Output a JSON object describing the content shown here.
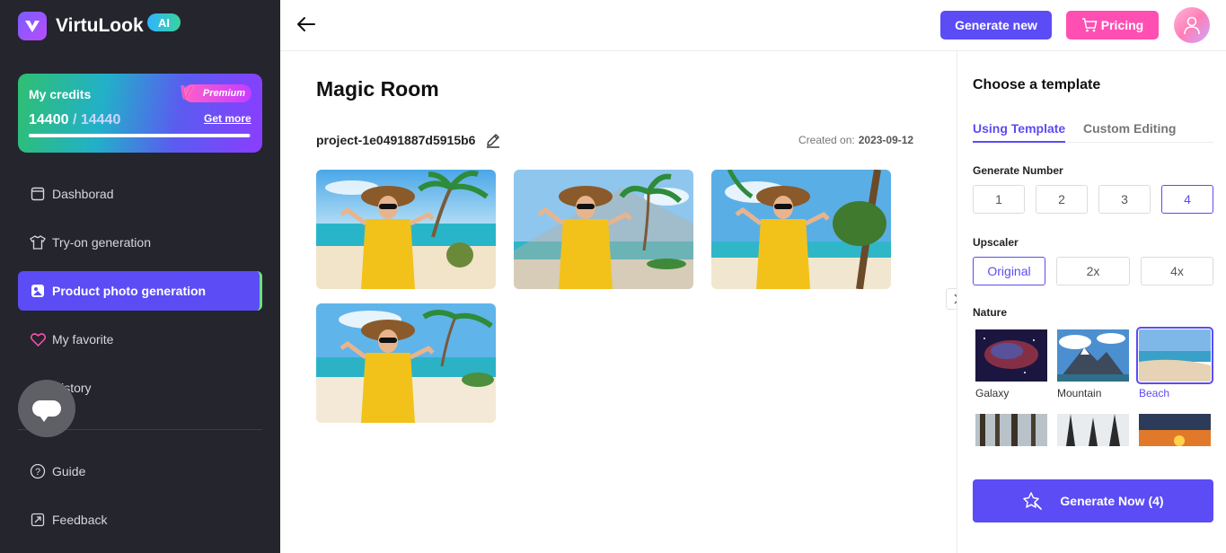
{
  "brand": {
    "name": "VirtuLook",
    "badge": "AI"
  },
  "credits": {
    "title": "My credits",
    "premium_label": "Premium",
    "premium_mark": "V",
    "used": "14400",
    "separator": "/",
    "total": "14440",
    "get_more": "Get more",
    "progress": 0.997
  },
  "nav": [
    {
      "label": "Dashborad",
      "icon": "dashboard-icon"
    },
    {
      "label": "Try-on generation",
      "icon": "shirt-icon"
    },
    {
      "label": "Product photo generation",
      "icon": "product-photo-icon",
      "active": true
    },
    {
      "label": "My favorite",
      "icon": "heart-icon"
    },
    {
      "label": "History",
      "icon": "history-icon"
    },
    {
      "label": "Guide",
      "icon": "help-icon"
    },
    {
      "label": "Feedback",
      "icon": "feedback-icon"
    }
  ],
  "header": {
    "generate_new": "Generate new",
    "pricing": "Pricing"
  },
  "project": {
    "title": "Magic Room",
    "id": "project-1e0491887d5915b6",
    "created_label": "Created on:",
    "created_date": "2023-09-12"
  },
  "results": [
    {
      "scene": "beach with palm trees"
    },
    {
      "scene": "beach with glass panel"
    },
    {
      "scene": "beach with large palm"
    },
    {
      "scene": "beach shoreline"
    }
  ],
  "panel": {
    "title": "Choose a template",
    "tabs": [
      "Using Template",
      "Custom Editing"
    ],
    "generate_number_label": "Generate Number",
    "generate_numbers": [
      "1",
      "2",
      "3",
      "4"
    ],
    "generate_number_selected": "4",
    "upscaler_label": "Upscaler",
    "upscaler_options": [
      "Original",
      "2x",
      "4x"
    ],
    "upscaler_selected": "Original",
    "nature_label": "Nature",
    "templates": [
      "Galaxy",
      "Mountain",
      "Beach"
    ],
    "template_selected": "Beach",
    "generate_now": "Generate Now (4)"
  },
  "colors": {
    "accent": "#5b4cf5",
    "pricing": "#ff4fb3",
    "sidebar": "#25252d"
  }
}
